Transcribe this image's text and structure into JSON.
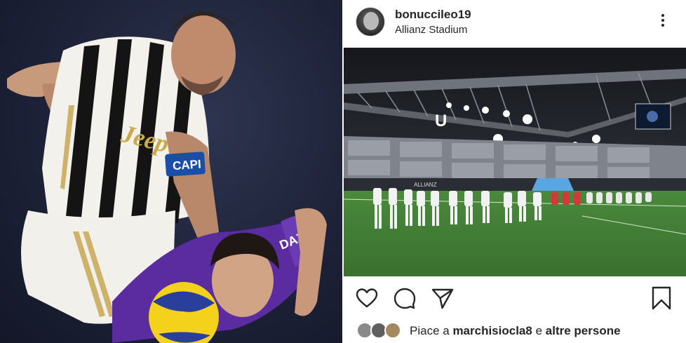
{
  "post": {
    "username": "bonuccileo19",
    "location": "Allianz Stadium",
    "likes_prefix": "Piace a",
    "liked_by": "marchisiocla8",
    "likes_joiner": "e",
    "likes_suffix": "altre persone"
  },
  "left_photo": {
    "sponsor_text": "Jeep",
    "captain_band": "CAPI",
    "opponent_shirt_text": "DAZN"
  },
  "post_image": {
    "scoreboard_letter": "U",
    "stand_text": "ALLIANZ"
  },
  "icons": {
    "more": "more-vertical-icon",
    "like": "heart-icon",
    "comment": "comment-icon",
    "share": "send-icon",
    "save": "bookmark-icon"
  },
  "colors": {
    "text": "#262626",
    "pitch": "#3f7a34",
    "juve_black": "#111111",
    "fiorentina_purple": "#5b2ba0"
  }
}
